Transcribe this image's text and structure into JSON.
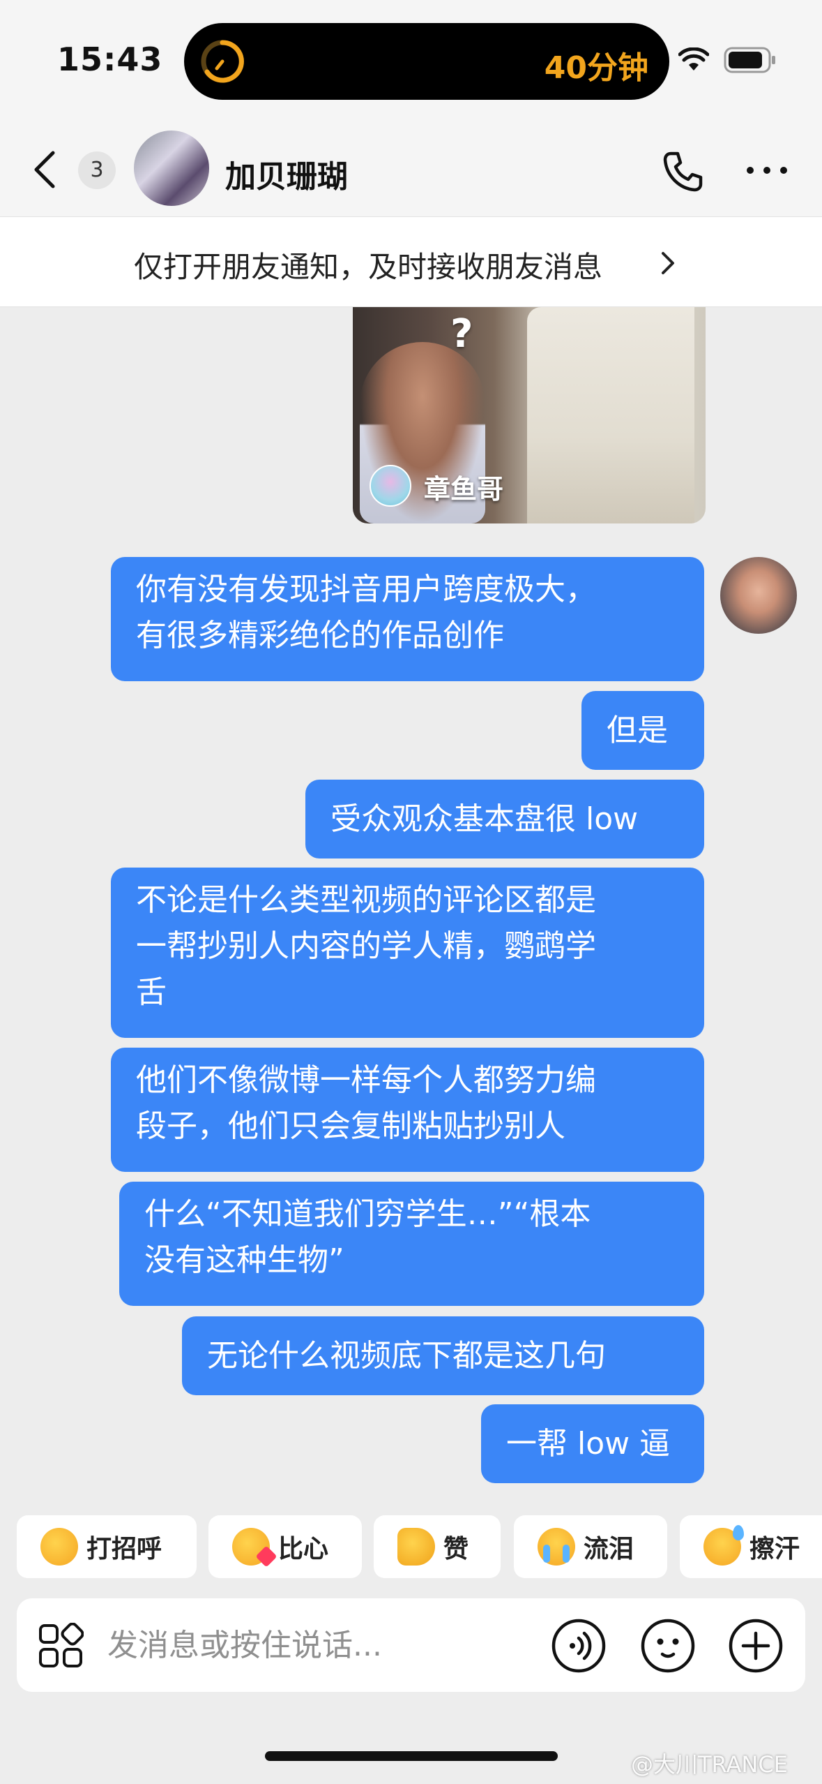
{
  "status_bar": {
    "time": "15:43",
    "island_text": "40分钟",
    "accent_color": "#f2a51d"
  },
  "header": {
    "unread_count": "3",
    "contact_name": "加贝珊瑚",
    "icons": [
      "back-icon",
      "phone-icon",
      "more-icon"
    ]
  },
  "banner": {
    "text": "仅打开朋友通知，及时接收朋友消息"
  },
  "shared_video": {
    "overlay_mark": "?",
    "author_name": "章鱼哥"
  },
  "messages": [
    {
      "lines": [
        "你有没有发现抖音用户跨度极大，",
        "有很多精彩绝伦的作品创作"
      ]
    },
    {
      "lines": [
        "但是"
      ]
    },
    {
      "lines": [
        "受众观众基本盘很 low"
      ]
    },
    {
      "lines": [
        "不论是什么类型视频的评论区都是",
        "一帮抄别人内容的学人精，鹦鹉学",
        "舌"
      ]
    },
    {
      "lines": [
        "他们不像微博一样每个人都努力编",
        "段子，他们只会复制粘贴抄别人"
      ]
    },
    {
      "lines": [
        "什么“不知道我们穷学生…”“根本",
        "没有这种生物”"
      ]
    },
    {
      "lines": [
        "无论什么视频底下都是这几句"
      ]
    },
    {
      "lines": [
        "一帮 low 逼"
      ]
    }
  ],
  "quick_replies": [
    {
      "label": "打招呼",
      "icon": "wave-emoji-icon"
    },
    {
      "label": "比心",
      "icon": "heart-hands-emoji-icon"
    },
    {
      "label": "赞",
      "icon": "thumbs-up-emoji-icon"
    },
    {
      "label": "流泪",
      "icon": "crying-emoji-icon"
    },
    {
      "label": "擦汗",
      "icon": "sweat-emoji-icon"
    }
  ],
  "input": {
    "placeholder": "发消息或按住说话...",
    "value": ""
  },
  "colors": {
    "bubble": "#3b86f7",
    "background": "#ededed"
  },
  "watermark": "@大川TRANCE"
}
